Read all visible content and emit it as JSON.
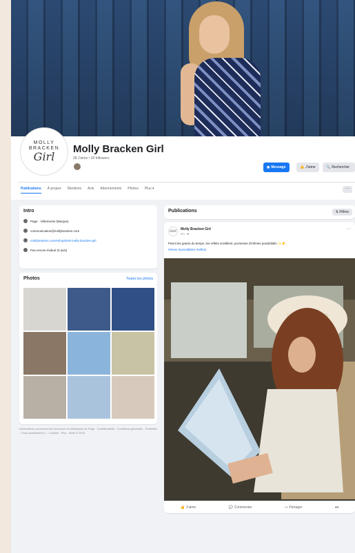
{
  "page": {
    "name": "Molly Bracken Girl",
    "stats": "28 J'aime • 33 followers",
    "logo": {
      "line1": "MOLLY",
      "line2": "BRACKEN",
      "script": "Girl"
    }
  },
  "header_buttons": {
    "message": "Message",
    "like": "J'aime",
    "search": "Rechercher"
  },
  "tabs": [
    "Publications",
    "À propos",
    "Mentions",
    "Avis",
    "Abonnements",
    "Photos",
    "Plus ▾"
  ],
  "more_button": "···",
  "intro": {
    "title": "Intro",
    "rows": [
      {
        "icon": "info-icon",
        "text": "Page · Vêtements (Marque)"
      },
      {
        "icon": "email-icon",
        "text": "communication@mollybracken.com"
      },
      {
        "icon": "link-icon",
        "text": "mollybracken.com/eshop/540-molly-bracken-girl"
      },
      {
        "icon": "star-icon",
        "text": "Pas encore évalué (0 avis)"
      }
    ]
  },
  "photos": {
    "title": "Photos",
    "all_link": "Toutes les photos",
    "tiles": [
      {
        "label": "photo-1",
        "color": "#d8d6d1"
      },
      {
        "label": "photo-2",
        "color": "#3d5a8a"
      },
      {
        "label": "photo-3",
        "color": "#2f4f86"
      },
      {
        "label": "photo-4",
        "color": "#8a7766"
      },
      {
        "label": "photo-5",
        "color": "#8bb4dc"
      },
      {
        "label": "photo-6",
        "color": "#c9c3a6"
      },
      {
        "label": "photo-7",
        "color": "#b8b0a4"
      },
      {
        "label": "photo-8",
        "color": "#aac3dd"
      },
      {
        "label": "photo-9",
        "color": "#d7cabc"
      }
    ]
  },
  "footer": "Informations concernant les annonces et statistiques de Page · Confidentialité · Conditions générales · Publicités · Choix publicitaires ▷ · Cookies · Plus · Meta © 2024",
  "publications": {
    "title": "Publications",
    "filter": "Filtres"
  },
  "post": {
    "author": "Molly Bracken Girl",
    "time": "4 h · ⊕",
    "text": "Parmi les grains du temps, les reflets scintillent, promesse d'infinies possibilités ✨☀️",
    "tags": "#rêves #possibilités #reflets",
    "actions": [
      "J'aime",
      "Commenter",
      "Partager"
    ]
  },
  "colors": {
    "accent": "#1877f2",
    "background": "#f0f2f5",
    "page_bg": "#f3e8de"
  }
}
